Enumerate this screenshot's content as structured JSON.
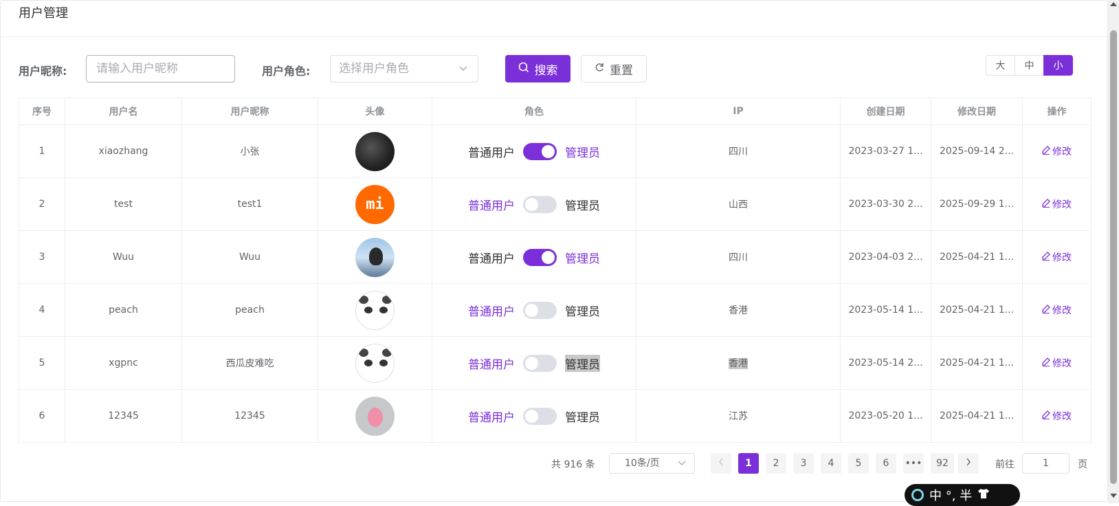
{
  "header": {
    "title": "用户管理"
  },
  "filters": {
    "nickname_label": "用户昵称:",
    "nickname_placeholder": "请输入用户昵称",
    "role_label": "用户角色:",
    "role_placeholder": "选择用户角色",
    "search_label": "搜索",
    "reset_label": "重置",
    "sizes": [
      "大",
      "中",
      "小"
    ],
    "active_size": "小"
  },
  "table": {
    "columns": [
      "序号",
      "用户名",
      "用户昵称",
      "头像",
      "角色",
      "IP",
      "创建日期",
      "修改日期",
      "操作"
    ],
    "role_user_label": "普通用户",
    "role_admin_label": "管理员",
    "edit_label": "修改",
    "rows": [
      {
        "index": "1",
        "username": "xiaozhang",
        "nickname": "小张",
        "avatar": "dark-photo",
        "is_admin": true,
        "ip": "四川",
        "created": "2023-03-27 1...",
        "modified": "2025-09-14 2..."
      },
      {
        "index": "2",
        "username": "test",
        "nickname": "test1",
        "avatar": "mi-logo",
        "is_admin": false,
        "ip": "山西",
        "created": "2023-03-30 2...",
        "modified": "2025-09-29 1..."
      },
      {
        "index": "3",
        "username": "Wuu",
        "nickname": "Wuu",
        "avatar": "sky-photo",
        "is_admin": true,
        "ip": "四川",
        "created": "2023-04-03 2...",
        "modified": "2025-04-21 1..."
      },
      {
        "index": "4",
        "username": "peach",
        "nickname": "peach",
        "avatar": "panda-drawing",
        "is_admin": false,
        "ip": "香港",
        "created": "2023-05-14 1...",
        "modified": "2025-04-21 1..."
      },
      {
        "index": "5",
        "username": "xgpnc",
        "nickname": "西瓜皮难吃",
        "avatar": "panda-drawing",
        "is_admin": false,
        "ip": "香港",
        "created": "2023-05-14 2...",
        "modified": "2025-04-21 1..."
      },
      {
        "index": "6",
        "username": "12345",
        "nickname": "12345",
        "avatar": "pink-bird",
        "is_admin": false,
        "ip": "江苏",
        "created": "2023-05-20 1...",
        "modified": "2025-04-21 1..."
      }
    ]
  },
  "avatar_text": {
    "mi": "mi"
  },
  "pagination": {
    "total_text": "共 916 条",
    "page_size": "10条/页",
    "pages": [
      "1",
      "2",
      "3",
      "4",
      "5",
      "6",
      "•••",
      "92"
    ],
    "current_page": "1",
    "goto_label": "前往",
    "goto_value": "1",
    "page_suffix": "页"
  },
  "ime": {
    "text": "中 °, 半"
  },
  "colors": {
    "accent": "#7b2fd9"
  }
}
